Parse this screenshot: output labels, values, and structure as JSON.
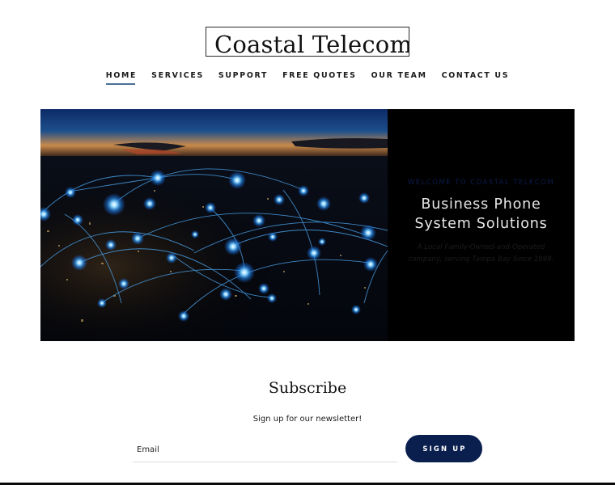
{
  "header": {
    "logo_text": "Coastal Telecom"
  },
  "nav": {
    "items": [
      {
        "label": "HOME",
        "active": true
      },
      {
        "label": "SERVICES",
        "active": false
      },
      {
        "label": "SUPPORT",
        "active": false
      },
      {
        "label": "FREE QUOTES",
        "active": false
      },
      {
        "label": "OUR TEAM",
        "active": false
      },
      {
        "label": "CONTACT US",
        "active": false
      }
    ],
    "active_underline_color": "#4a6f94"
  },
  "hero": {
    "image_description": "Night city skyline with glowing blue network nodes and connecting arcs",
    "kicker": "WELCOME TO COASTAL TELECOM",
    "headline_line1": "Business Phone",
    "headline_line2": "System Solutions",
    "tagline_line1": "A Local Family-Owned-and-Operated",
    "tagline_line2": "company, serving Tampa Bay Since 1998.",
    "panel_color": "#000000",
    "kicker_color": "#0c1c4c"
  },
  "subscribe": {
    "title": "Subscribe",
    "subtitle": "Sign up for our newsletter!",
    "email_placeholder": "Email",
    "email_value": "",
    "button_label": "SIGN UP",
    "button_color": "#0b1f4f"
  }
}
